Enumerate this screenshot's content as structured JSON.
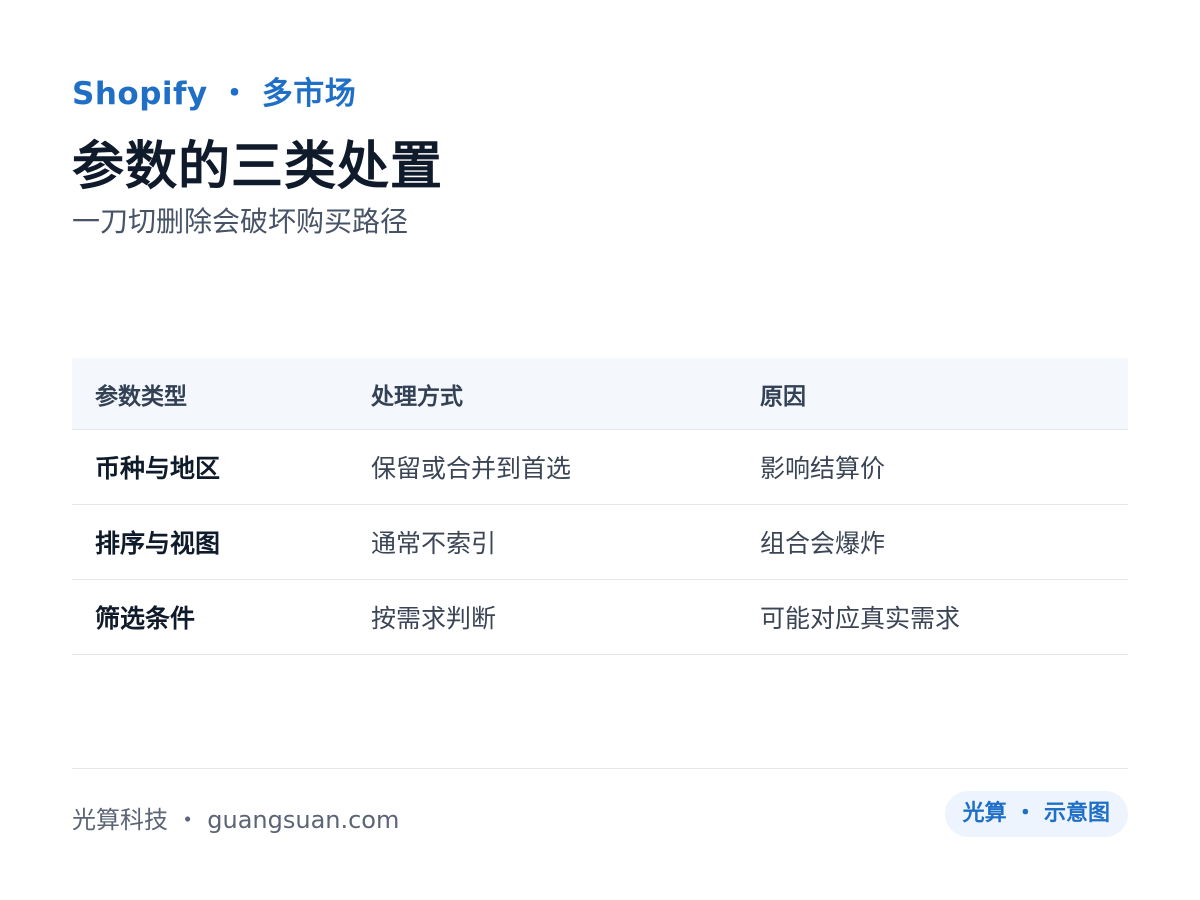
{
  "header": {
    "kicker": "Shopify ・ 多市场",
    "title": "参数的三类处置",
    "subtitle": "一刀切删除会破坏购买路径"
  },
  "table": {
    "columns": [
      "参数类型",
      "处理方式",
      "原因"
    ],
    "rows": [
      [
        "币种与地区",
        "保留或合并到首选",
        "影响结算价"
      ],
      [
        "排序与视图",
        "通常不索引",
        "组合会爆炸"
      ],
      [
        "筛选条件",
        "按需求判断",
        "可能对应真实需求"
      ]
    ]
  },
  "footer": {
    "left": "光算科技 ・ guangsuan.com",
    "badge": "光算 ・ 示意图"
  },
  "colors": {
    "accent": "#1f6fc6",
    "title": "#0f1a2b",
    "header_bg": "#f4f8fd",
    "badge_bg": "#eef4fd"
  }
}
